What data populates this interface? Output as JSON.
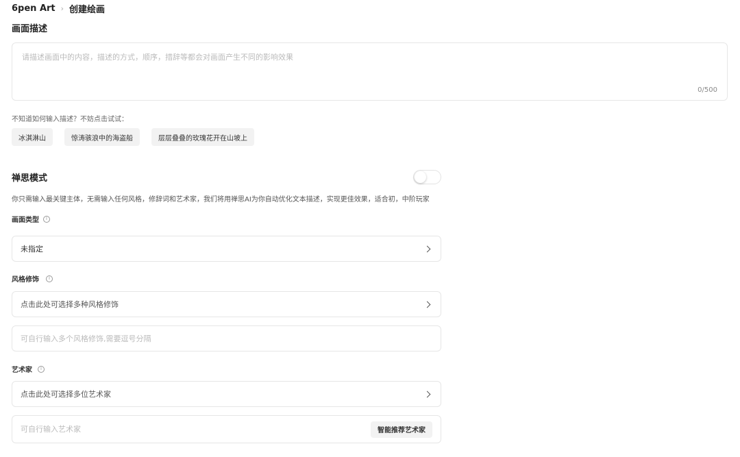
{
  "breadcrumb": {
    "app": "6pen Art",
    "separator": "›",
    "current": "创建绘画"
  },
  "prompt": {
    "title": "画面描述",
    "placeholder": "请描述画面中的内容，描述的方式，顺序，措辞等都会对画面产生不同的影响效果",
    "value": "",
    "counter": "0/500"
  },
  "suggestions": {
    "hint": "不知道如何输入描述？不妨点击试试：",
    "items": [
      "冰淇淋山",
      "惊涛骇浪中的海盗船",
      "层层叠叠的玫瑰花开在山坡上"
    ]
  },
  "zen_mode": {
    "title": "禅思模式",
    "enabled": false,
    "description": "你只需输入最关键主体，无需输入任何风格，修辞词和艺术家，我们将用禅思AI为你自动优化文本描述，实现更佳效果，适合初，中阶玩家"
  },
  "image_type": {
    "label": "画面类型",
    "value": "未指定"
  },
  "style": {
    "label": "风格修饰",
    "select_text": "点击此处可选择多种风格修饰",
    "input_placeholder": "可自行输入多个风格修饰,需要逗号分隔"
  },
  "artist": {
    "label": "艺术家",
    "select_text": "点击此处可选择多位艺术家",
    "input_placeholder": "可自行输入艺术家",
    "recommend_button": "智能推荐艺术家"
  },
  "icons": {
    "info": "info-icon",
    "chevron": "chevron-right-icon",
    "info_glyph": "i"
  }
}
